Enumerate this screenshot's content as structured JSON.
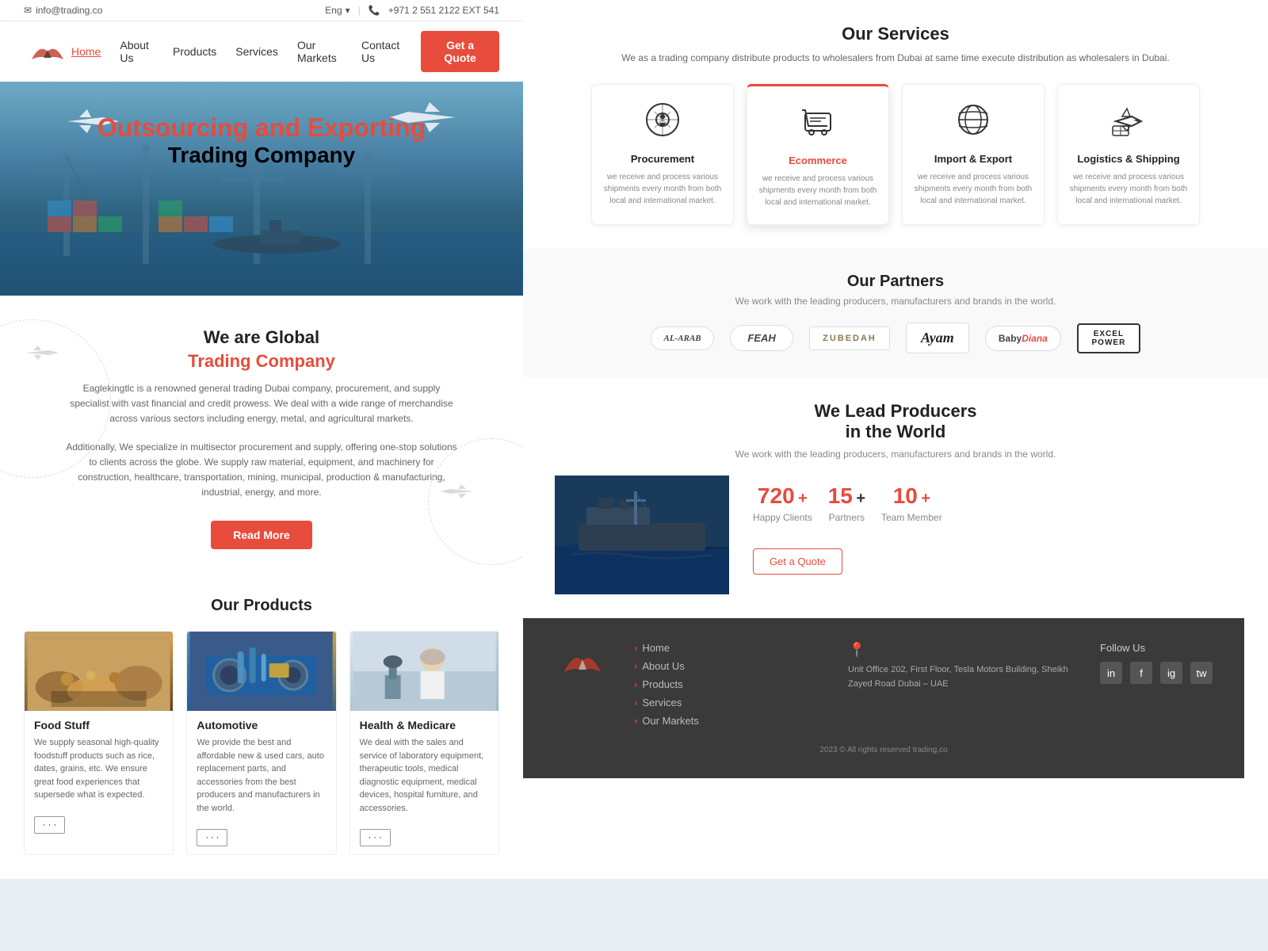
{
  "topbar": {
    "email": "info@trading.co",
    "lang": "Eng",
    "phone": "+971 2 551 2122 EXT 541"
  },
  "header": {
    "nav": [
      {
        "label": "Home",
        "active": true
      },
      {
        "label": "About Us",
        "active": false
      },
      {
        "label": "Products",
        "active": false
      },
      {
        "label": "Services",
        "active": false
      },
      {
        "label": "Our Markets",
        "active": false
      },
      {
        "label": "Contact Us",
        "active": false
      }
    ],
    "cta_label": "Get a Quote"
  },
  "hero": {
    "line1": "Outsourcing and Exporting",
    "line2": "Trading Company"
  },
  "global": {
    "title1": "We are Global",
    "title2": "Trading Company",
    "desc1": "Eaglekingtlc is a renowned general trading Dubai company, procurement, and supply specialist with vast financial and credit prowess. We deal with a wide range of merchandise across various sectors including energy, metal, and agricultural markets.",
    "desc2": "Additionally, We specialize in multisector procurement and supply, offering one-stop solutions to clients across the globe. We supply raw material, equipment, and machinery for construction, healthcare, transportation, mining, municipal, production & manufacturing, industrial, energy, and more.",
    "btn_label": "Read More"
  },
  "products_section": {
    "title": "Our Products",
    "items": [
      {
        "name": "Food Stuff",
        "desc": "We supply seasonal high-quality foodstuff products such as rice, dates, grains, etc. We ensure great food experiences that supersede what is expected.",
        "btn": "..."
      },
      {
        "name": "Automotive",
        "desc": "We provide the best and affordable new & used cars, auto replacement parts, and accessories from the best producers and manufacturers in the world.",
        "btn": "..."
      },
      {
        "name": "Health & Medicare",
        "desc": "We deal with the sales and service of laboratory equipment, therapeutic tools, medical diagnostic equipment, medical devices, hospital furniture, and accessories.",
        "btn": "..."
      }
    ]
  },
  "services": {
    "title": "Our Services",
    "desc": "We as a trading company distribute products to wholesalers from Dubai at same time execute distribution as wholesalers in Dubai.",
    "items": [
      {
        "name": "Procurement",
        "text": "we receive and process various shipments every month from both local and international market.",
        "active": false
      },
      {
        "name": "Ecommerce",
        "text": "we receive and process various shipments every month from both local and international market.",
        "active": true
      },
      {
        "name": "Import & Export",
        "text": "we receive and process various shipments every month from both local and international market.",
        "active": false
      },
      {
        "name": "Logistics & Shipping",
        "text": "we receive and process various shipments every month from both local and international market.",
        "active": false
      }
    ]
  },
  "partners": {
    "title": "Our Partners",
    "desc": "We work with the leading producers, manufacturers and brands in the world.",
    "logos": [
      "AL-ARAB",
      "FEAH",
      "ZUBEDAH",
      "Ayam",
      "BabyDiana",
      "EXCEL POWER"
    ]
  },
  "producers": {
    "title": "We Lead Producers in the World",
    "desc": "We work with the leading producers, manufacturers and brands in the world.",
    "stats": [
      {
        "number": "720",
        "plus": "+",
        "label": "Happy Clients"
      },
      {
        "number": "15",
        "plus": "+",
        "label": "Partners"
      },
      {
        "number": "10",
        "plus": "+",
        "label": "Team Member"
      }
    ],
    "btn_label": "Get a Quote"
  },
  "footer": {
    "nav_links": [
      "Home",
      "About Us",
      "Products",
      "Services",
      "Our Markets"
    ],
    "address_label": "Unit Office 202, First Floor, Tesla Motors Building, Sheikh Zayed Road Dubai – UAE",
    "social_title": "Follow Us",
    "social_links": [
      "in",
      "f",
      "ig",
      "tw"
    ],
    "copyright": "2023 © All rights reserved trading.co"
  }
}
